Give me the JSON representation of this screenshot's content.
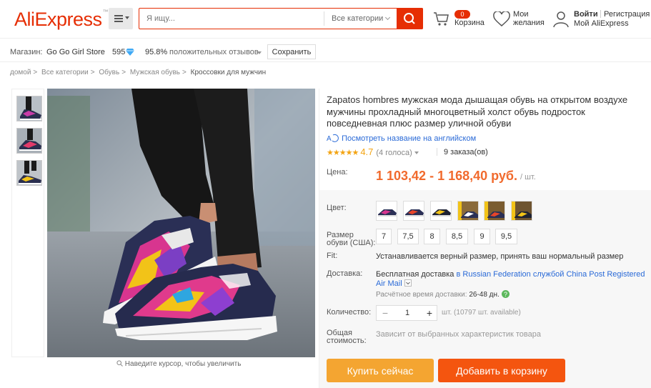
{
  "header": {
    "logo": "AliExpress",
    "search_placeholder": "Я ищу...",
    "category": "Все категории",
    "cart_count": "0",
    "cart_label": "Корзина",
    "wishlist_label": "Мои желания",
    "signin": "Войти",
    "register": "Регистрация",
    "my_account": "Мой AliExpress"
  },
  "store": {
    "label": "Магазин:",
    "name": "Go Go Girl Store",
    "score": "595",
    "positive_pct": "95.8%",
    "positive_label": "положительных отзывов",
    "save": "Сохранить"
  },
  "breadcrumbs": [
    "домой",
    "Все категории",
    "Обувь",
    "Мужская обувь",
    "Кроссовки для мужчин"
  ],
  "breadcrumb_sep": ">",
  "gallery": {
    "zoom_hint": "Наведите курсор, чтобы увеличить"
  },
  "product": {
    "title": "Zapatos hombres мужская мода дышащая обувь на открытом воздухе мужчины прохладный многоцветный холст обувь подросток повседневная плюс размер уличной обуви",
    "translate_link": "Посмотреть название на английском",
    "rating": "4.7",
    "votes": "(4 голоса)",
    "orders": "9 заказа(ов)",
    "price_label": "Цена:",
    "price": "1 103,42 - 1 168,40 руб.",
    "price_unit": "/ шт.",
    "color_label": "Цвет:",
    "size_label": "Размер обуви (США):",
    "sizes": [
      "7",
      "7,5",
      "8",
      "8,5",
      "9",
      "9,5"
    ],
    "fit_label": "Fit:",
    "fit_text": "Устанавливается верный размер, принять ваш нормальный размер",
    "delivery_label": "Доставка:",
    "delivery_free": "Бесплатная доставка",
    "delivery_rest": "в Russian Federation службой China Post Registered Air Mail",
    "delivery_time_label": "Расчётное время доставки:",
    "delivery_time": "26-48 дн.",
    "qty_label": "Количество:",
    "qty_value": "1",
    "qty_avail": "шт. (10797 шт. available)",
    "total_label": "Общая стоимость:",
    "total_text": "Зависит от выбранных характеристик товара",
    "buy_now": "Купить сейчас",
    "add_to_cart": "Добавить в корзину"
  },
  "colors": {
    "brand": "#e62e04",
    "price": "#f16a2d",
    "buy": "#f4a531",
    "cart": "#f4550f",
    "link": "#2a6ad7"
  }
}
